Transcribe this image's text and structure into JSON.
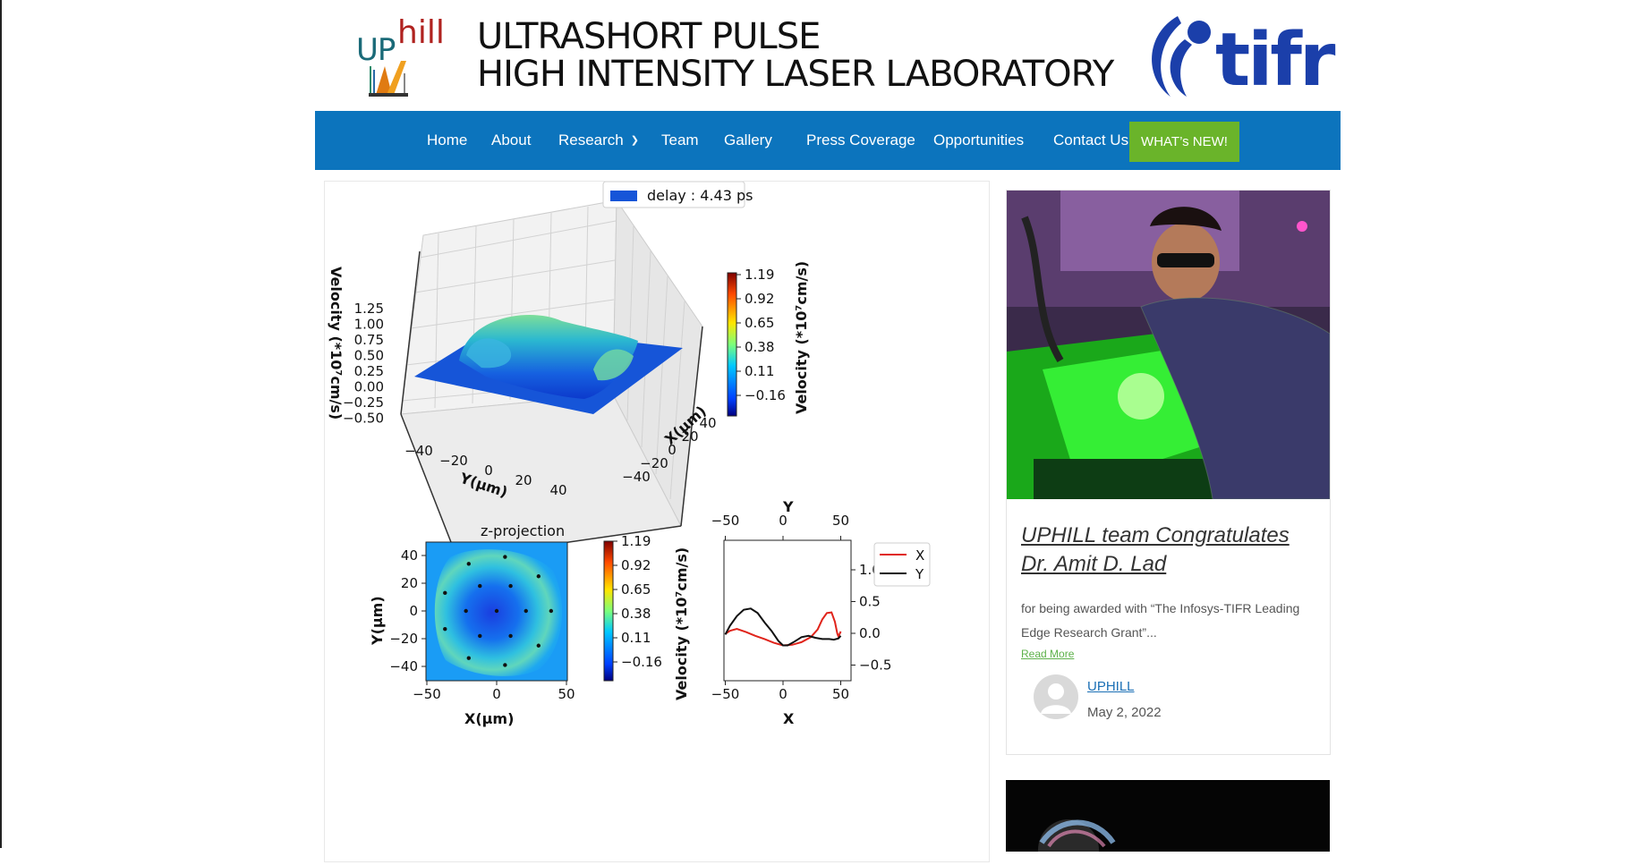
{
  "header": {
    "logo_up": "UP",
    "logo_hill": "hill",
    "title_line1": "ULTRASHORT PULSE",
    "title_line2": "HIGH INTENSITY LASER LABORATORY",
    "tifr_logo_text": "tifr"
  },
  "nav": {
    "items": [
      {
        "label": "Home"
      },
      {
        "label": "About"
      },
      {
        "label": "Research"
      },
      {
        "label": "Team"
      },
      {
        "label": "Gallery"
      },
      {
        "label": "Press Coverage"
      },
      {
        "label": "Opportunities"
      },
      {
        "label": "Contact Us"
      }
    ],
    "highlight_label": "WHAT’s NEW!",
    "colors": {
      "bar": "#0c74bd",
      "highlight": "#6ab42a"
    }
  },
  "figure": {
    "legend_label": "delay : 4.43 ps",
    "surface_zlabel": "Velocity (*10⁷cm/s)",
    "surface_xlabel": "X(μm)",
    "surface_ylabel": "Y(μm)",
    "colorbar_label": "Velocity (*10⁷cm/s)",
    "projection_title": "z-projection",
    "projection_xlabel": "X(μm)",
    "projection_ylabel": "Y(μm)",
    "lineout_top_label": "Y",
    "lineout_bottom_label": "X",
    "lineout_legend_x": "X",
    "lineout_legend_y": "Y"
  },
  "chart_data": [
    {
      "type": "surface",
      "legend": [
        "delay : 4.43 ps"
      ],
      "zlabel": "Velocity (*10⁷cm/s)",
      "xlabel": "X(μm)",
      "ylabel": "Y(μm)",
      "z_ticks": [
        "1.25",
        "1.00",
        "0.75",
        "0.50",
        "0.25",
        "0.00",
        "−0.25",
        "−0.50"
      ],
      "x_ticks": [
        "−40",
        "−20",
        "0",
        "20",
        "40"
      ],
      "y_ticks": [
        "−40",
        "−20",
        "0",
        "20",
        "40"
      ],
      "colorbar_ticks": [
        "1.19",
        "0.92",
        "0.65",
        "0.38",
        "0.11",
        "−0.16"
      ],
      "colorbar_label": "Velocity (*10⁷cm/s)"
    },
    {
      "type": "heatmap",
      "title": "z-projection",
      "xlabel": "X(μm)",
      "ylabel": "Y(μm)",
      "x_ticks": [
        "−50",
        "0",
        "50"
      ],
      "y_ticks": [
        "40",
        "20",
        "0",
        "−20",
        "−40"
      ],
      "xlim": [
        -50,
        50
      ],
      "ylim": [
        -50,
        50
      ],
      "colorbar_ticks": [
        "1.19",
        "0.92",
        "0.65",
        "0.38",
        "0.11",
        "−0.16"
      ],
      "colorbar_label": "Velocity (*10⁷cm/s)",
      "points": [
        [
          -20,
          34
        ],
        [
          6,
          39
        ],
        [
          30,
          25
        ],
        [
          -12,
          18
        ],
        [
          10,
          18
        ],
        [
          -37,
          13
        ],
        [
          -22,
          0
        ],
        [
          0,
          0
        ],
        [
          21,
          0
        ],
        [
          39,
          0
        ],
        [
          -37,
          -13
        ],
        [
          -12,
          -18
        ],
        [
          10,
          -18
        ],
        [
          30,
          -25
        ],
        [
          -20,
          -34
        ],
        [
          6,
          -39
        ]
      ]
    },
    {
      "type": "line",
      "xlabel": "X",
      "top_xlabel": "Y",
      "x_ticks": [
        "−50",
        "0",
        "50"
      ],
      "y_ticks": [
        "1.0",
        "0.5",
        "0.0",
        "−0.5"
      ],
      "xlim": [
        -53,
        53
      ],
      "ylim": [
        -0.73,
        1.07
      ],
      "series": [
        {
          "name": "X",
          "color": "#e0241b",
          "x": [
            -50,
            -46,
            -40,
            -32,
            -24,
            -16,
            -8,
            0,
            8,
            16,
            24,
            30,
            34,
            38,
            42,
            45,
            47,
            48,
            50
          ],
          "y": [
            -0.01,
            0.04,
            0.07,
            0.02,
            -0.04,
            -0.09,
            -0.15,
            -0.19,
            -0.18,
            -0.14,
            -0.06,
            0.06,
            0.22,
            0.32,
            0.33,
            0.18,
            0.0,
            -0.05,
            0.03
          ]
        },
        {
          "name": "Y",
          "color": "#111111",
          "x": [
            -50,
            -46,
            -40,
            -34,
            -28,
            -22,
            -16,
            -10,
            -4,
            0,
            4,
            10,
            16,
            22,
            28,
            34,
            40,
            44,
            48,
            50
          ],
          "y": [
            -0.02,
            0.12,
            0.27,
            0.37,
            0.39,
            0.32,
            0.17,
            0.04,
            -0.12,
            -0.19,
            -0.19,
            -0.13,
            -0.06,
            -0.04,
            -0.07,
            -0.09,
            -0.09,
            -0.1,
            -0.08,
            -0.04
          ]
        }
      ]
    }
  ],
  "sidebar": {
    "post": {
      "title": "UPHILL team Congratulates Dr. Amit D. Lad",
      "excerpt": "for being awarded with “The Infosys-TIFR Leading Edge Research Grant”...",
      "read_more": "Read More",
      "author": "UPHILL",
      "date": "May 2, 2022"
    }
  }
}
